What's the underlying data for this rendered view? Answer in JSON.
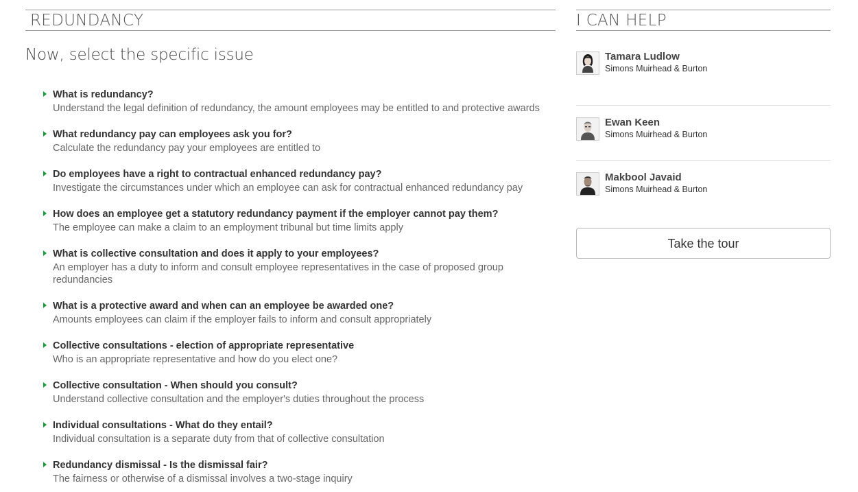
{
  "left": {
    "section_title": "REDUNDANCY",
    "subheading": "Now, select the specific issue",
    "issues": [
      {
        "title": "What is redundancy?",
        "desc": "Understand the legal definition of redundancy, the amount employees may be entitled to and protective awards"
      },
      {
        "title": "What redundancy pay can employees ask you for?",
        "desc": "Calculate the redundancy pay your employees are entitled to"
      },
      {
        "title": "Do employees have a right to contractual enhanced redundancy pay?",
        "desc": "Investigate the circumstances under which an employee can ask for contractual enhanced redundancy pay"
      },
      {
        "title": "How does an employee get a statutory redundancy payment if the employer cannot pay them?",
        "desc": "The employee can make a claim to an employment tribunal but time limits apply"
      },
      {
        "title": "What is collective consultation and does it apply to your employees?",
        "desc": "An employer has a duty to inform and consult employee representatives in the case of proposed group redundancies"
      },
      {
        "title": "What is a protective award and when can an employee be awarded one?",
        "desc": "Amounts employees can claim if the employer fails to inform and consult appropriately"
      },
      {
        "title": "Collective consultations - election of appropriate representative",
        "desc": "Who is an appropriate representative and how do you elect one?"
      },
      {
        "title": "Collective consultation - When should you consult?",
        "desc": "Understand collective consultation and the employer's duties throughout the process"
      },
      {
        "title": "Individual consultations - What do they entail?",
        "desc": "Individual consultation is a separate duty from that of collective consultation"
      },
      {
        "title": "Redundancy dismissal - Is the dismissal fair?",
        "desc": "The fairness or otherwise of a dismissal involves a two-stage inquiry"
      }
    ]
  },
  "right": {
    "section_title": "I CAN HELP",
    "experts": [
      {
        "name": "Tamara Ludlow",
        "firm": "Simons Muirhead & Burton",
        "avatar_icon": "person-photo-icon"
      },
      {
        "name": "Ewan Keen",
        "firm": "Simons Muirhead & Burton",
        "avatar_icon": "person-photo-icon"
      },
      {
        "name": "Makbool Javaid",
        "firm": "Simons Muirhead & Burton",
        "avatar_icon": "person-photo-icon"
      }
    ],
    "tour_button": "Take the tour"
  },
  "colors": {
    "arrow": "#1a9a3c",
    "rule": "#9a9a9a",
    "heading_text": "#555555"
  }
}
